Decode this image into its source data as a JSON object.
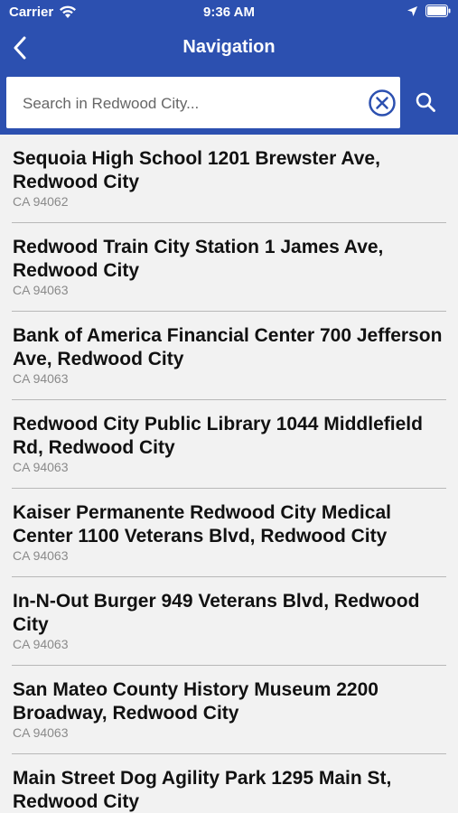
{
  "status_bar": {
    "carrier": "Carrier",
    "time": "9:36 AM",
    "wifi_icon": "wifi-icon",
    "location_icon": "location-arrow-icon",
    "battery_icon": "battery-icon"
  },
  "nav": {
    "title": "Navigation",
    "back_icon": "chevron-left-icon"
  },
  "search": {
    "placeholder": "Search in Redwood City...",
    "value": "",
    "clear_icon": "clear-circle-icon",
    "search_icon": "search-icon"
  },
  "colors": {
    "header": "#2c50b0",
    "background": "#f2f2f2",
    "separator": "#b8b8b8",
    "subtext": "#8a8a8a"
  },
  "results": [
    {
      "name": "Sequoia High School 1201 Brewster Ave, Redwood City",
      "sub": "CA 94062"
    },
    {
      "name": "Redwood Train City Station 1 James Ave, Redwood City",
      "sub": "CA 94063"
    },
    {
      "name": "Bank of America Financial Center 700 Jefferson Ave, Redwood City",
      "sub": "CA 94063"
    },
    {
      "name": "Redwood City Public Library 1044 Middlefield Rd, Redwood City",
      "sub": "CA 94063"
    },
    {
      "name": "Kaiser Permanente Redwood City Medical Center 1100 Veterans Blvd, Redwood City",
      "sub": "CA 94063"
    },
    {
      "name": "In-N-Out Burger 949 Veterans Blvd, Redwood City",
      "sub": "CA 94063"
    },
    {
      "name": "San Mateo County History Museum 2200 Broadway, Redwood City",
      "sub": "CA 94063"
    },
    {
      "name": "Main Street Dog Agility Park 1295 Main St, Redwood City",
      "sub": ""
    }
  ]
}
